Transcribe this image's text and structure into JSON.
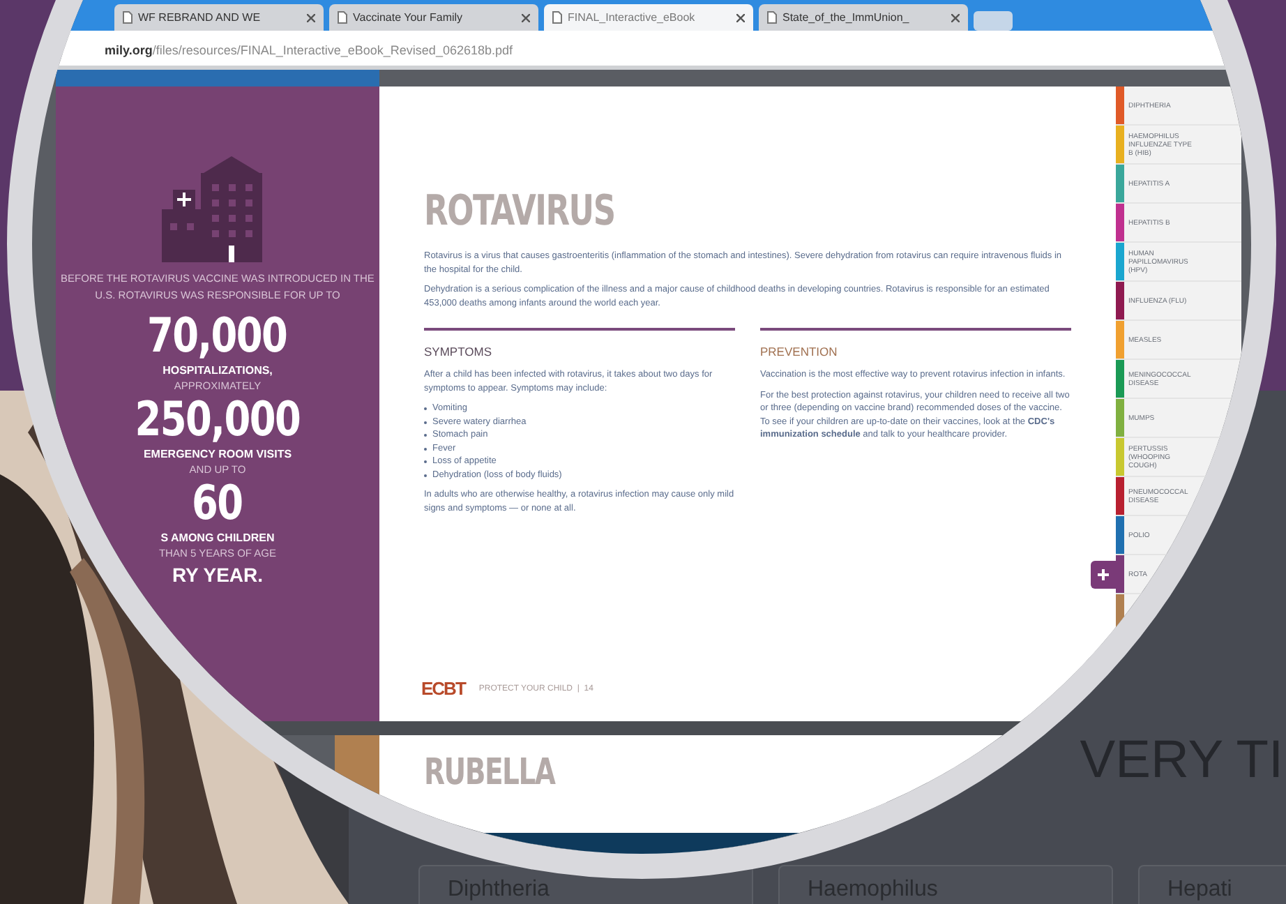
{
  "background": {
    "tagline": "VERY TI",
    "cards": [
      "Diphtheria",
      "Haemophilus",
      "Hepati"
    ]
  },
  "browser": {
    "tabs": [
      {
        "title": "WF REBRAND AND WE",
        "selected": false
      },
      {
        "title": "Vaccinate Your Family",
        "selected": false
      },
      {
        "title": "FINAL_Interactive_eBook",
        "selected": true
      },
      {
        "title": "State_of_the_ImmUnion_",
        "selected": false
      }
    ],
    "url_host": "mily.org",
    "url_path": "/files/resources/FINAL_Interactive_eBook_Revised_062618b.pdf"
  },
  "sidebar": {
    "intro": "BEFORE THE ROTAVIRUS VACCINE WAS INTRODUCED IN THE U.S. ROTAVIRUS WAS RESPONSIBLE FOR UP TO",
    "stats": [
      {
        "kind": "number",
        "text": "70,000"
      },
      {
        "kind": "strong",
        "text": "HOSPITALIZATIONS,"
      },
      {
        "kind": "light",
        "text": "APPROXIMATELY"
      },
      {
        "kind": "number",
        "text": "250,000"
      },
      {
        "kind": "strong",
        "text": "EMERGENCY ROOM VISITS"
      },
      {
        "kind": "light",
        "text": "AND UP TO"
      },
      {
        "kind": "number",
        "text": "60"
      },
      {
        "kind": "strong",
        "text": "S AMONG CHILDREN"
      },
      {
        "kind": "light",
        "text": "THAN 5 YEARS OF AGE"
      },
      {
        "kind": "closing",
        "text": "RY YEAR."
      }
    ]
  },
  "page": {
    "title": "ROTAVIRUS",
    "intro": [
      "Rotavirus is a virus that causes gastroenteritis (inflammation of the stomach and intestines). Severe dehydration from rotavirus can require intravenous fluids in the hospital for the child.",
      "Dehydration is a serious complication of the illness and a major cause of childhood deaths in developing countries. Rotavirus is responsible for an estimated 453,000 deaths among infants around the world each year."
    ],
    "symptoms": {
      "heading": "SYMPTOMS",
      "lead": "After a child has been infected with rotavirus, it takes about two days for symptoms to appear. Symptoms may include:",
      "bullets": [
        "Vomiting",
        "Severe watery diarrhea",
        "Stomach pain",
        "Fever",
        "Loss of appetite",
        "Dehydration (loss of body fluids)"
      ],
      "closing": "In adults who are otherwise healthy, a rotavirus infection may cause only mild signs and symptoms — or none at all."
    },
    "prevention": {
      "heading": "PREVENTION",
      "paragraphs": [
        "Vaccination is the most effective way to prevent rotavirus infection in infants.",
        "For the best protection against rotavirus, your children need to receive all two or three (depending on vaccine brand) recommended doses of the vaccine. To see if your children are up-to-date on their vaccines, look at the **CDC's immunization schedule** and talk to your healthcare provider."
      ]
    },
    "footer_logo": "ECBT",
    "footer": "PROTECT YOUR CHILD  |  14",
    "next_title": "RUBELLA"
  },
  "side_tabs": [
    {
      "label": "DIPHTHERIA",
      "color": "#e05a28",
      "selected": false
    },
    {
      "label": "HAEMOPHILUS INFLUENZAE TYPE B (HIB)",
      "color": "#e8b020",
      "selected": false
    },
    {
      "label": "HEPATITIS A",
      "color": "#3aa79b",
      "selected": false
    },
    {
      "label": "HEPATITIS B",
      "color": "#c0308f",
      "selected": false
    },
    {
      "label": "HUMAN PAPILLOMAVIRUS (HPV)",
      "color": "#1aa6cf",
      "selected": false
    },
    {
      "label": "INFLUENZA (FLU)",
      "color": "#8f1a50",
      "selected": false
    },
    {
      "label": "MEASLES",
      "color": "#f0a030",
      "selected": false
    },
    {
      "label": "MENINGOCOCCAL DISEASE",
      "color": "#1a9a55",
      "selected": false
    },
    {
      "label": "MUMPS",
      "color": "#80b040",
      "selected": false
    },
    {
      "label": "PERTUSSIS (WHOOPING COUGH)",
      "color": "#c8c830",
      "selected": false
    },
    {
      "label": "PNEUMOCOCCAL DISEASE",
      "color": "#b82030",
      "selected": false
    },
    {
      "label": "POLIO",
      "color": "#2070b0",
      "selected": false
    },
    {
      "label": "ROTA",
      "color": "#7a3a78",
      "selected": true
    },
    {
      "color": "#b08050",
      "selected": false
    }
  ]
}
